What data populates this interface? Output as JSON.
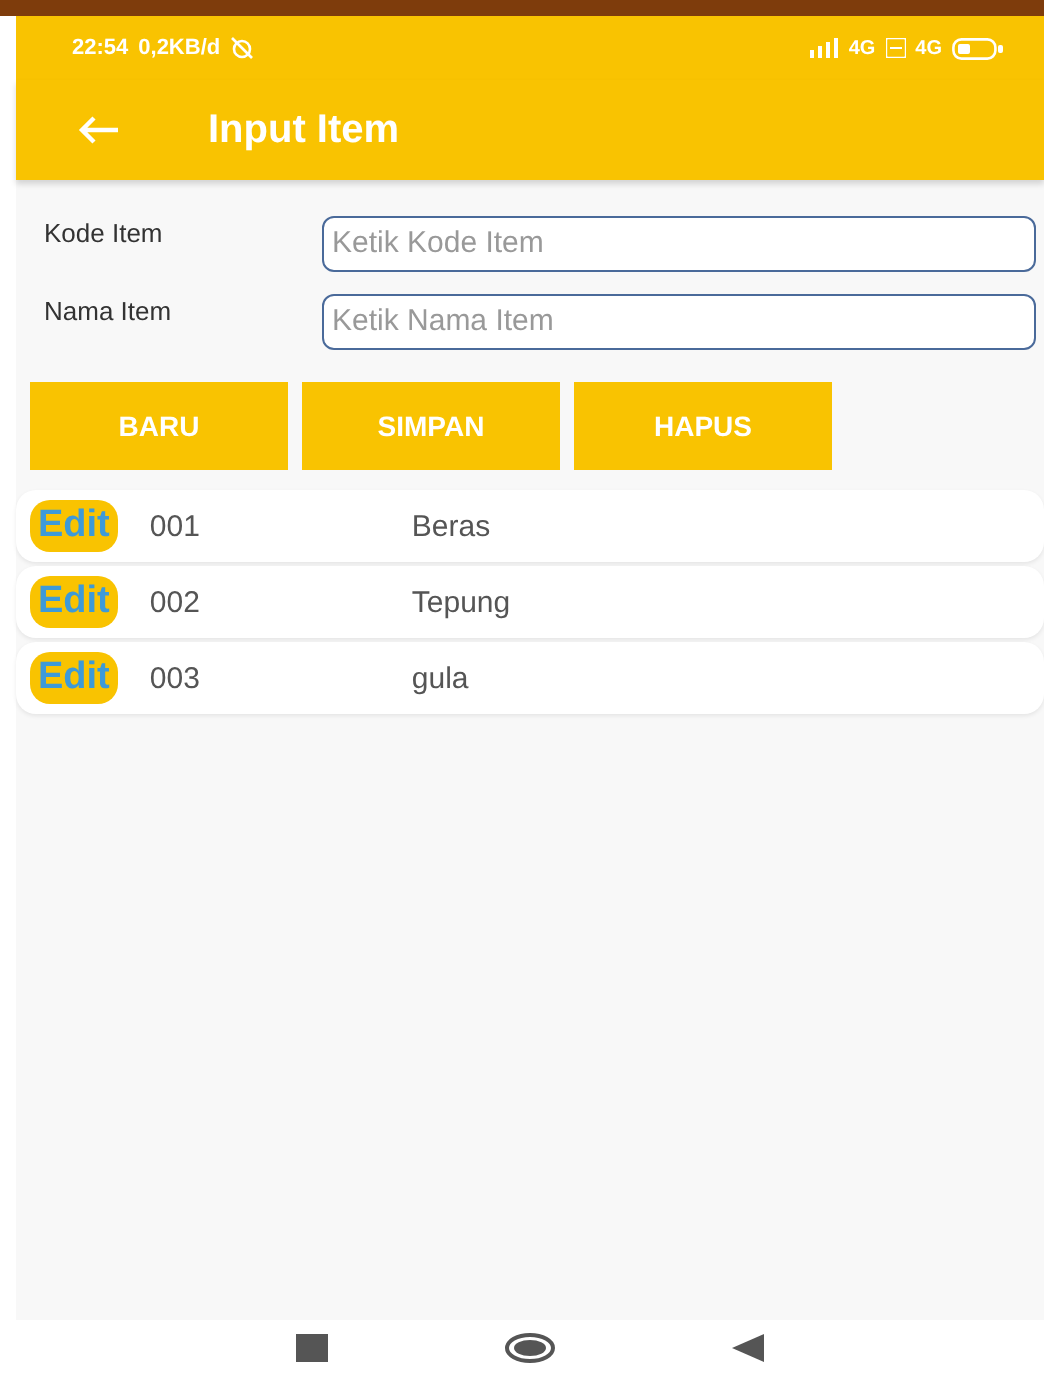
{
  "status_bar": {
    "time": "22:54",
    "speed": "0,2KB/d",
    "network_1": "4G",
    "network_2": "4G"
  },
  "app_bar": {
    "title": "Input Item"
  },
  "form": [
    {
      "label": "Kode Item",
      "placeholder": "Ketik Kode Item"
    },
    {
      "label": "Nama Item",
      "placeholder": "Ketik Nama Item"
    }
  ],
  "buttons": [
    "BARU",
    "SIMPAN",
    "HAPUS"
  ],
  "items": [
    {
      "action": "Edit",
      "code": "001",
      "name": "Beras"
    },
    {
      "action": "Edit",
      "code": "002",
      "name": "Tepung"
    },
    {
      "action": "Edit",
      "code": "003",
      "name": "gula"
    }
  ]
}
